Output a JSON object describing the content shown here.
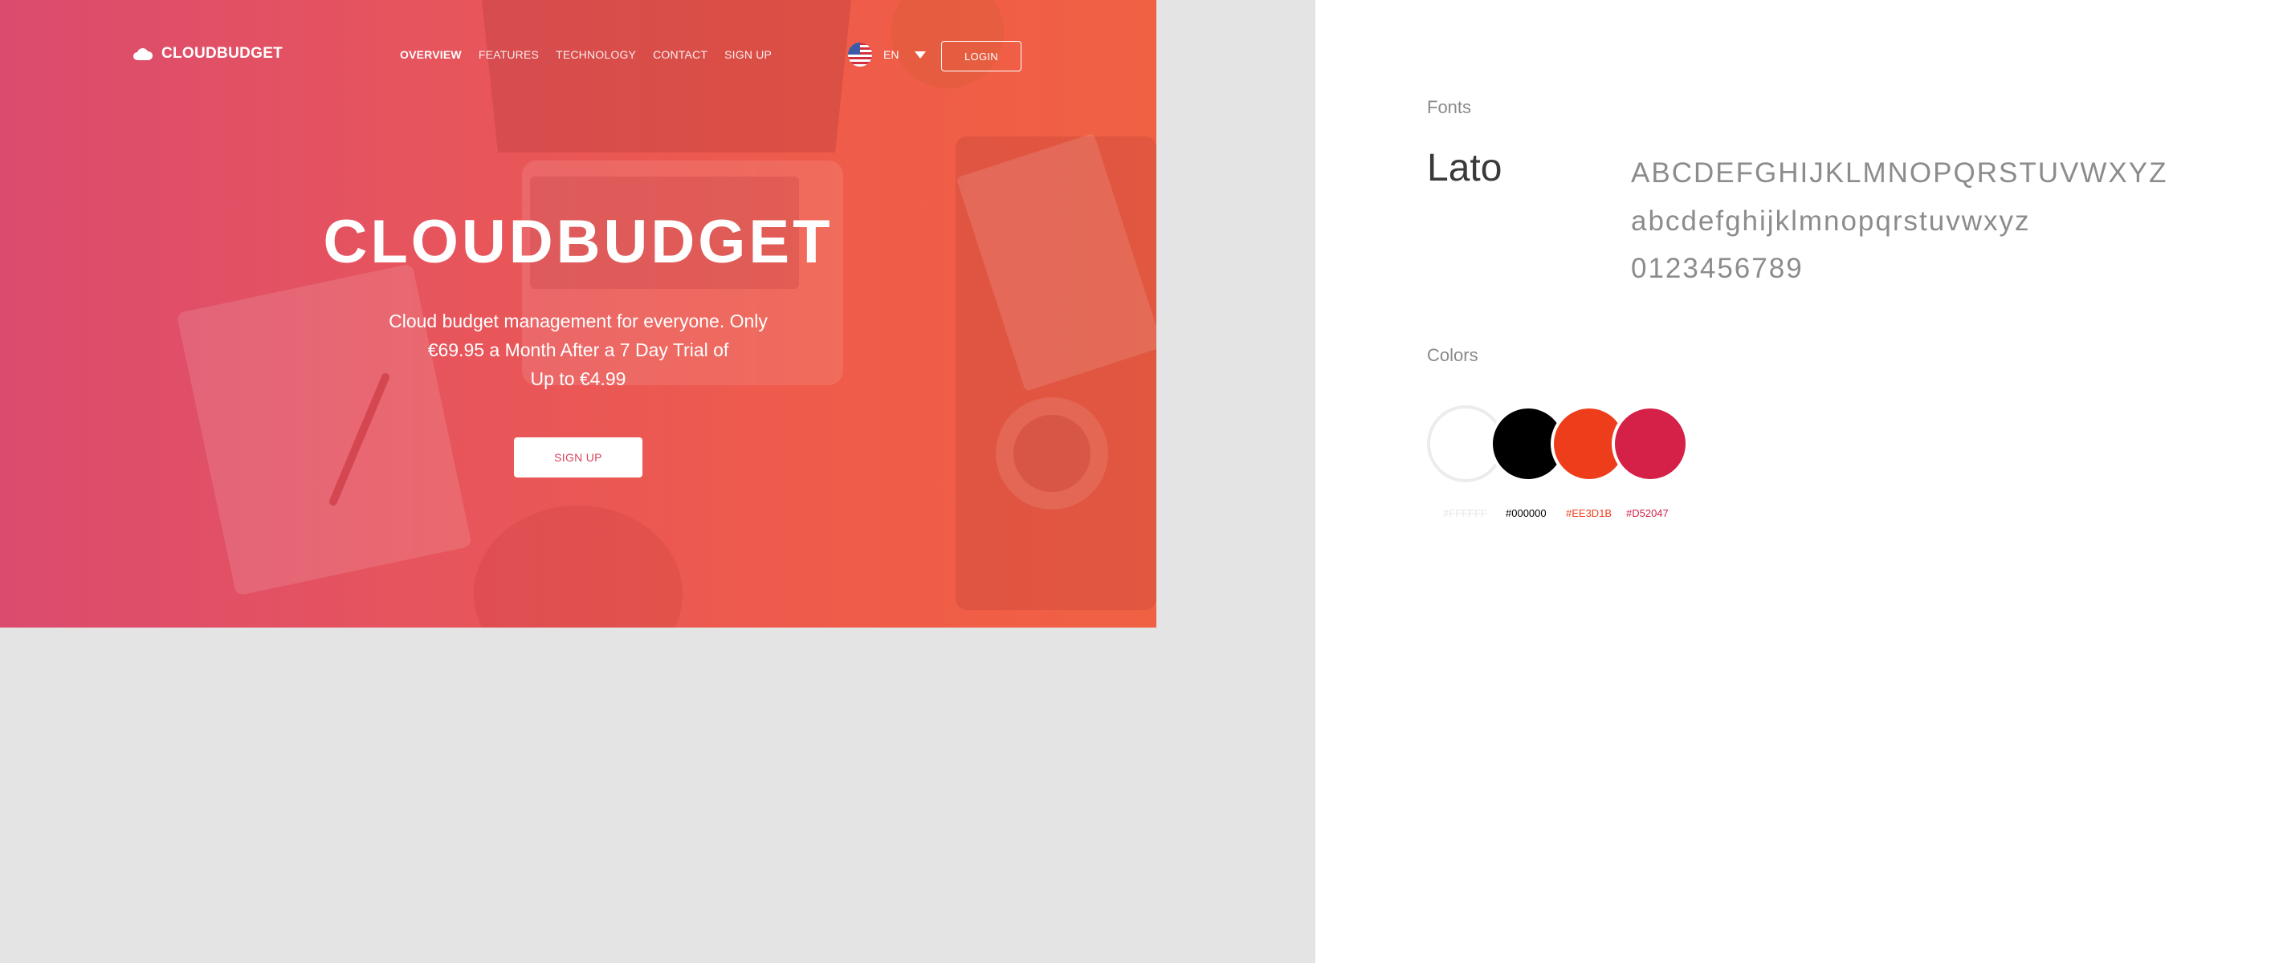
{
  "hero": {
    "logo_text": "CLOUDBUDGET",
    "nav": [
      "OVERVIEW",
      "FEATURES",
      "TECHNOLOGY",
      "CONTACT",
      "SIGN UP"
    ],
    "lang": "EN",
    "login": "LOGIN",
    "title": "CLOUDBUDGET",
    "subtitle_lines": [
      "Cloud budget management for everyone. Only",
      "€69.95 a Month After a 7 Day Trial of",
      "Up to €4.99"
    ],
    "cta": "SIGN UP"
  },
  "guide": {
    "fonts_label": "Fonts",
    "font_name": "Lato",
    "upper": "ABCDEFGHIJKLMNOPQRSTUVWXYZ",
    "lower": "abcdefghijklmnopqrstuvwxyz",
    "digits": "0123456789",
    "colors_label": "Colors",
    "colors": [
      {
        "hex": "#FFFFFF",
        "label": "#FFFFFF"
      },
      {
        "hex": "#000000",
        "label": "#000000"
      },
      {
        "hex": "#EE3D1B",
        "label": "#EE3D1B"
      },
      {
        "hex": "#D52047",
        "label": "#D52047"
      }
    ]
  }
}
